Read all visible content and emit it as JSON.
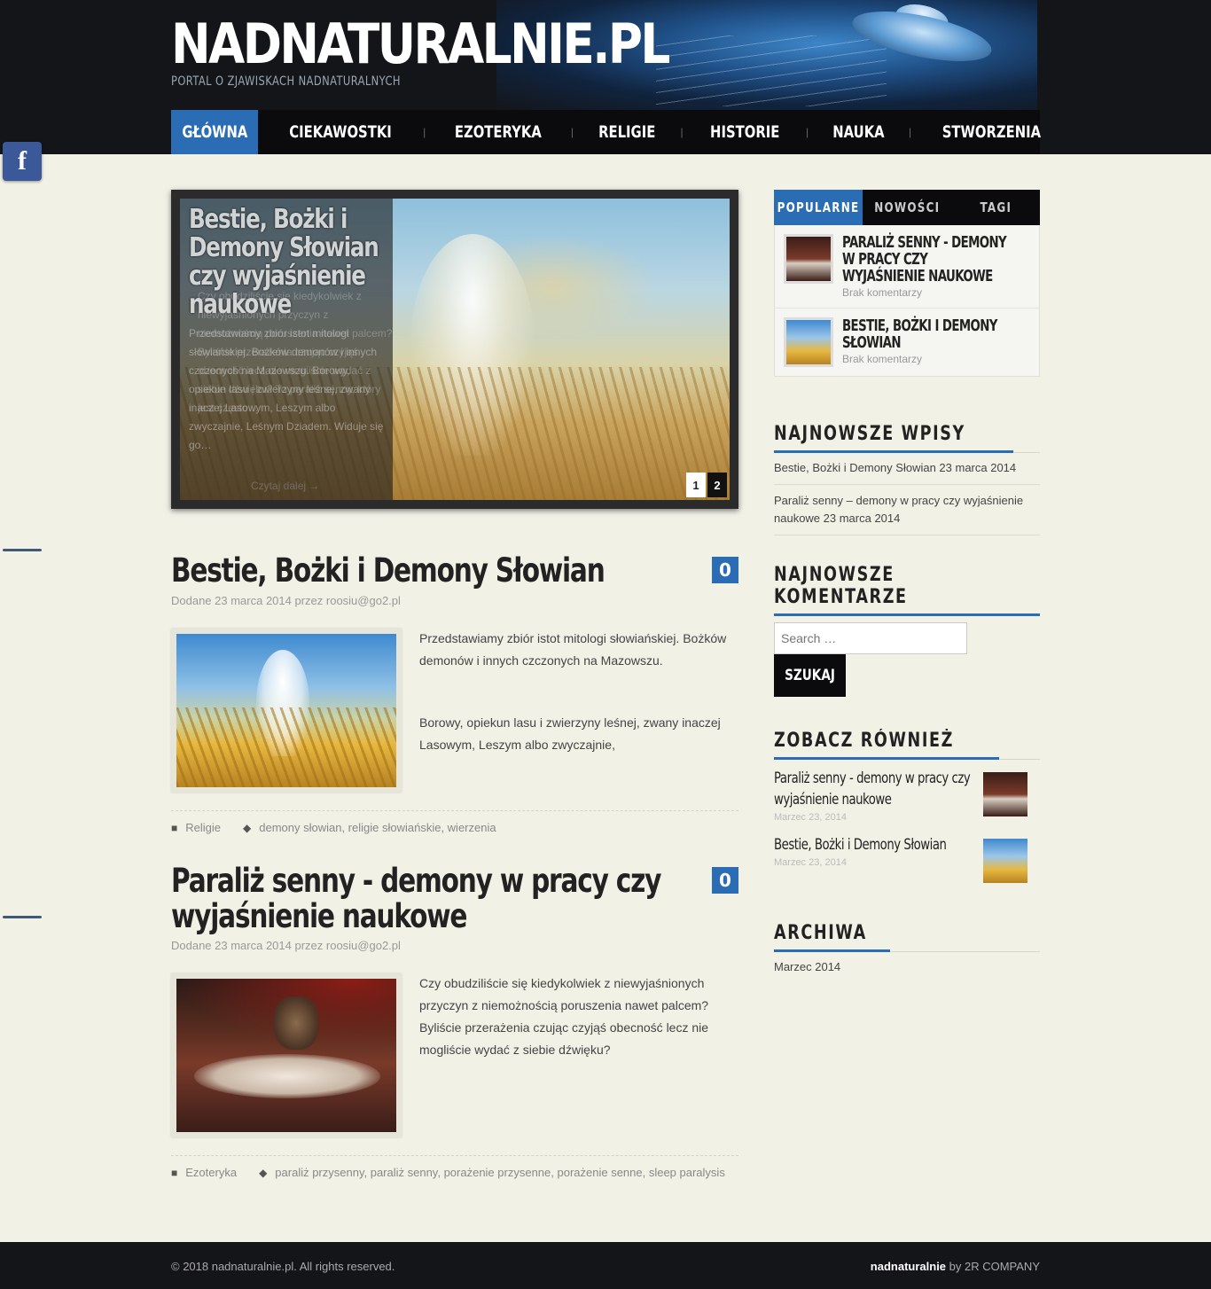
{
  "site": {
    "title": "NADNATURALNIE.PL",
    "tagline": "PORTAL O ZJAWISKACH NADNATURALNYCH"
  },
  "nav": {
    "items": [
      "GŁÓWNA",
      "CIEKAWOSTKI",
      "EZOTERYKA",
      "RELIGIE",
      "HISTORIE",
      "NAUKA",
      "STWORZENIA"
    ],
    "active": "GŁÓWNA"
  },
  "facebook": {
    "icon": "facebook-icon",
    "label": "f"
  },
  "slider": {
    "title": "Bestie, Bożki i Demony Słowian czy wyjaśnienie naukowe",
    "text": "Przedstawiamy zbiór istot mitologi słowiańskiej. Bożków demonów i innych czczonych na Mazowszu.   Borowy, opiekun lasu i zwierzyny leśnej, zwany inaczej Lasowym, Leszym albo zwyczajnie, Leśnym Dziadem. Widuje się go…",
    "text2": "Czy obudziliście się kiedykolwiek z niewyjaśnionych przyczyn z niemożnością poruszenia nawet palcem? Byliście przerażenia czując czyjąś obecność lecz nie mogliście wydać z siebie dźwięku? To paraliż senny, który jest często…",
    "more": "Czytaj dalej →",
    "pages": [
      "1",
      "2"
    ],
    "active_page": "1"
  },
  "posts": [
    {
      "title": "Bestie, Bożki i Demony Słowian",
      "comments": "0",
      "meta": "Dodane 23 marca 2014 przez roosiu@go2.pl",
      "excerpt": [
        "Przedstawiamy zbiór istot mitologi słowiańskiej. Bożków demonów i innych czczonych na Mazowszu.",
        "Borowy, opiekun lasu i zwierzyny leśnej, zwany inaczej Lasowym, Leszym albo zwyczajnie,"
      ],
      "category": "Religie",
      "tags": "demony słowian, religie słowiańskie, wierzenia"
    },
    {
      "title": "Paraliż senny - demony w pracy czy wyjaśnienie naukowe",
      "comments": "0",
      "meta": "Dodane 23 marca 2014 przez roosiu@go2.pl",
      "excerpt": [
        "Czy obudziliście się kiedykolwiek z niewyjaśnionych przyczyn z niemożnością poruszenia nawet palcem? Byliście przerażenia czując czyjąś obecność lecz nie mogliście wydać z siebie dźwięku?"
      ],
      "category": "Ezoteryka",
      "tags": "paraliż przysenny, paraliż senny, porażenie przysenne, porażenie senne, sleep paralysis"
    }
  ],
  "sidebar": {
    "tabs": [
      "POPULARNE",
      "NOWOŚCI",
      "TAGI"
    ],
    "active_tab": "POPULARNE",
    "popular": [
      {
        "title": "PARALIŻ SENNY - DEMONY W PRACY CZY WYJAŚNIENIE NAUKOWE",
        "sub": "Brak komentarzy"
      },
      {
        "title": "BESTIE, BOŻKI I DEMONY SŁOWIAN",
        "sub": "Brak komentarzy"
      }
    ],
    "recent_posts_title": "NAJNOWSZE WPISY",
    "recent_posts": [
      "Bestie, Bożki i Demony Słowian 23 marca 2014",
      "Paraliż senny – demony w pracy czy wyjaśnienie naukowe 23 marca 2014"
    ],
    "recent_comments_title": "NAJNOWSZE KOMENTARZE",
    "search": {
      "placeholder": "Search …",
      "button": "SZUKAJ"
    },
    "see_also_title": "ZOBACZ RÓWNIEŻ",
    "see_also": [
      {
        "title": "Paraliż senny - demony w pracy czy wyjaśnienie naukowe",
        "date": "Marzec 23, 2014"
      },
      {
        "title": "Bestie, Bożki i Demony Słowian",
        "date": "Marzec 23, 2014"
      }
    ],
    "archive_title": "ARCHIWA",
    "archive": [
      "Marzec 2014"
    ]
  },
  "footer": {
    "copy": "© 2018 nadnaturalnie.pl. All rights reserved.",
    "credit_site": "nadnaturalnie",
    "credit_by": " by 2R COMPANY"
  },
  "colors": {
    "accent": "#2a6db5",
    "header_bg": "#141519",
    "page_bg": "#f1f1e6"
  }
}
